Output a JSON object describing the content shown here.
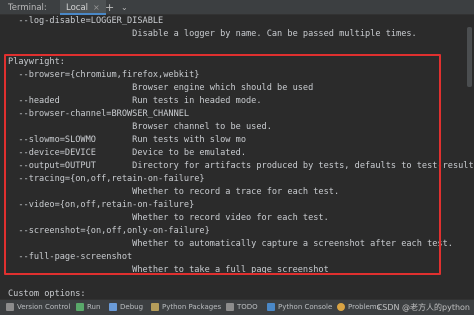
{
  "tabs": {
    "label": "Terminal:",
    "active": "Local",
    "close": "×",
    "add": "+",
    "dropdown": "⌄"
  },
  "terminal_lines": [
    "  --log-disable=LOGGER_DISABLE",
    "                        Disable a logger by name. Can be passed multiple times.",
    "",
    "Playwright:",
    "  --browser={chromium,firefox,webkit}",
    "                        Browser engine which should be used",
    "  --headed              Run tests in headed mode.",
    "  --browser-channel=BROWSER_CHANNEL",
    "                        Browser channel to be used.",
    "  --slowmo=SLOWMO       Run tests with slow mo",
    "  --device=DEVICE       Device to be emulated.",
    "  --output=OUTPUT       Directory for artifacts produced by tests, defaults to test-results.",
    "  --tracing={on,off,retain-on-failure}",
    "                        Whether to record a trace for each test.",
    "  --video={on,off,retain-on-failure}",
    "                        Whether to record video for each test.",
    "  --screenshot={on,off,only-on-failure}",
    "                        Whether to automatically capture a screenshot after each test.",
    "  --full-page-screenshot",
    "                        Whether to take a full page screenshot",
    "",
    "Custom options:"
  ],
  "statusbar": {
    "items": [
      {
        "label": "Version Control",
        "icon": "branch-icon",
        "color": "#8c8c8c"
      },
      {
        "label": "Run",
        "icon": "run-icon",
        "color": "#59a869"
      },
      {
        "label": "Debug",
        "icon": "bug-icon",
        "color": "#6a9bd8"
      },
      {
        "label": "Python Packages",
        "icon": "packages-icon",
        "color": "#b59d5a"
      },
      {
        "label": "TODO",
        "icon": "todo-icon",
        "color": "#8c8c8c"
      },
      {
        "label": "Python Console",
        "icon": "python-icon",
        "color": "#4a88c7"
      },
      {
        "label": "Problems",
        "icon": "problems-icon",
        "color": "#d9a343"
      }
    ],
    "watermark": "CSDN @老方人的python"
  },
  "colors": {
    "highlight_border": "#e0302f",
    "background": "#2b2b2b",
    "text": "#c9ccd0"
  }
}
